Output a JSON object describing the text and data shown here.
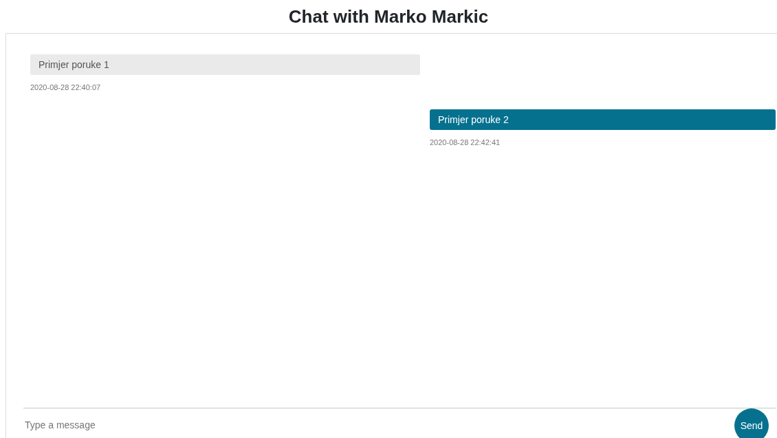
{
  "title": "Chat with Marko Markic",
  "messages": [
    {
      "kind": "received",
      "text": "Primjer poruke 1",
      "time": "2020-08-28 22:40:07"
    },
    {
      "kind": "sent",
      "text": "Primjer poruke 2",
      "time": "2020-08-28 22:42:41"
    }
  ],
  "composer": {
    "placeholder": "Type a message",
    "send": "Send"
  }
}
